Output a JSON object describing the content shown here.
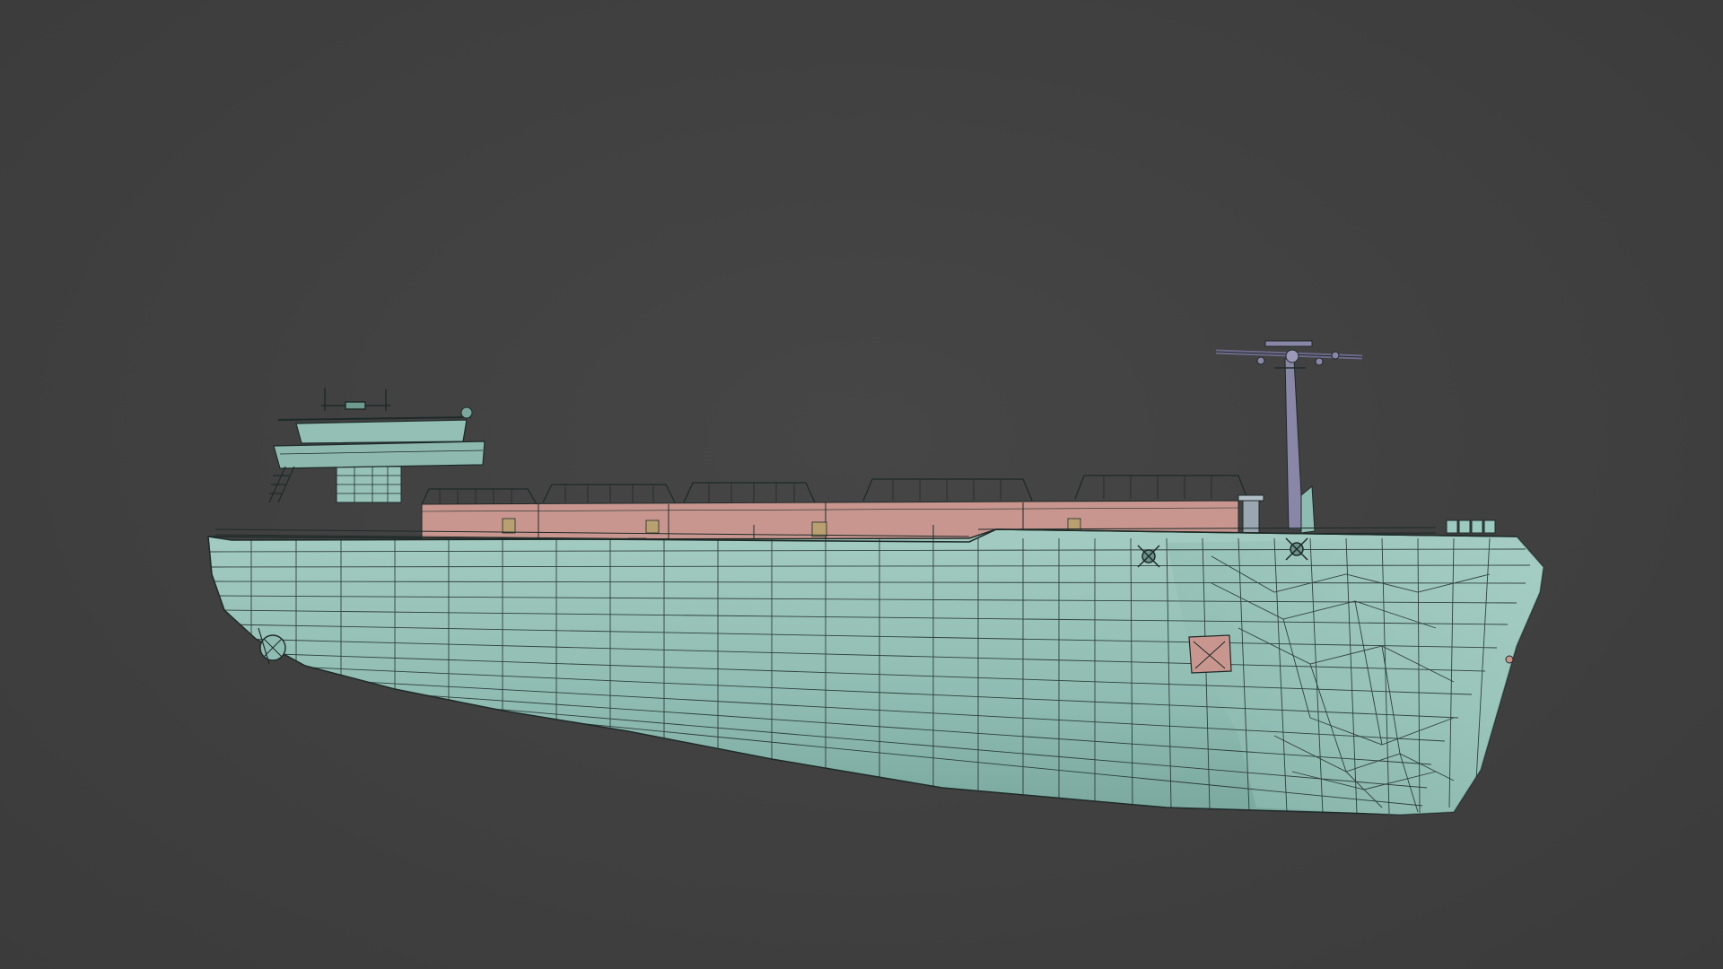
{
  "viewport": {
    "background_color": "#404040",
    "shading": "solid-with-wireframe"
  },
  "model": {
    "subject": "cargo ship",
    "hull_color": "#8fbcb2",
    "deck_color": "#c9968f",
    "mast_color": "#8a86a8",
    "wire_color": "#1e2a28"
  }
}
